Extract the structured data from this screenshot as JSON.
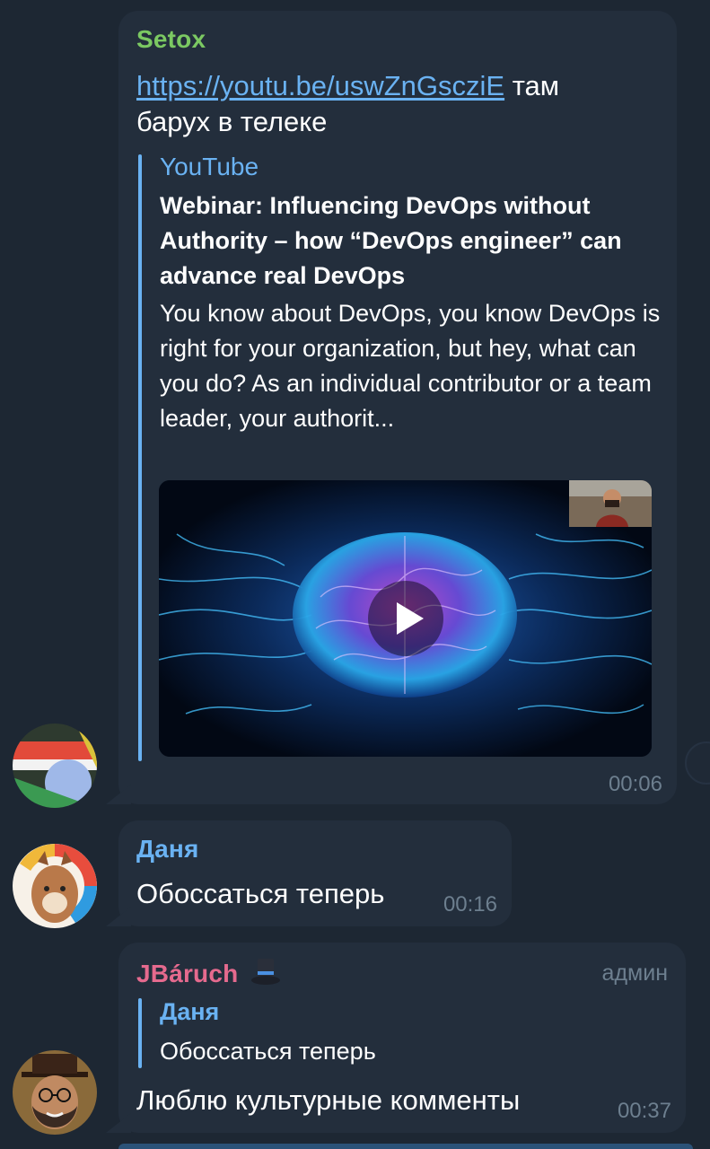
{
  "messages": {
    "first": {
      "sender": "Setox",
      "sender_color": "#7bc862",
      "link": "https://youtu.be/uswZnGscziE",
      "text_after_link": " там",
      "text_line2": "барух в телеке",
      "preview": {
        "site": "YouTube",
        "title": "Webinar: Influencing DevOps without Authority – how “DevOps engineer” can advance real DevOps",
        "description": "You know about DevOps, you know DevOps is right for your organization, but hey, what can you do? As an individual contributor or a team leader, your authorit..."
      },
      "time": "00:06"
    },
    "second": {
      "sender": "Даня",
      "sender_color": "#6ab2f2",
      "text": "Обоссаться теперь",
      "time": "00:16"
    },
    "third": {
      "sender": "JBáruch",
      "sender_color": "#e56a8e",
      "badge_icon": "top-hat-icon",
      "admin_label": "админ",
      "reply": {
        "name": "Даня",
        "text": "Обоссаться теперь"
      },
      "text": "Люблю культурные комменты",
      "time": "00:37"
    }
  },
  "colors": {
    "background": "#1d2733",
    "bubble": "#232e3c",
    "accent": "#6ab2f2",
    "muted": "#6d7f8f"
  }
}
